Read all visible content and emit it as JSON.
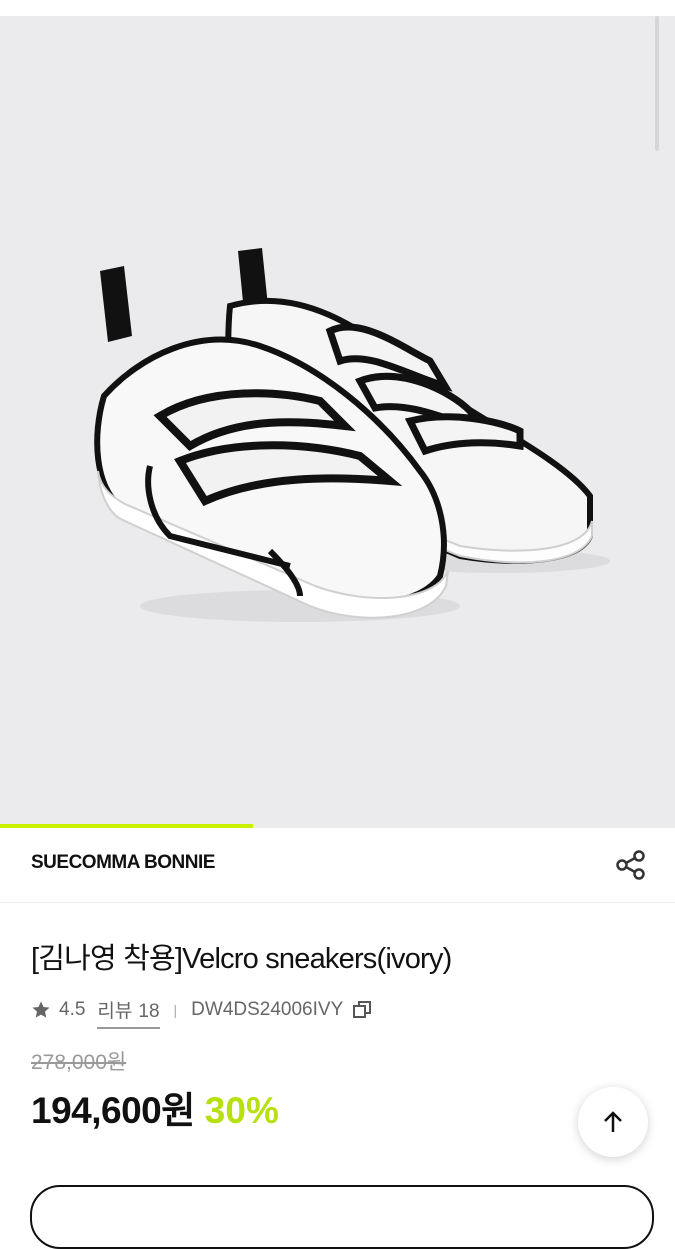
{
  "gallery": {
    "image_alt": "Velcro sneakers ivory product photo",
    "progress_fraction": 0.375
  },
  "brand": {
    "name": "SUECOMMA BONNIE",
    "share_icon": "share-icon"
  },
  "product": {
    "title": "[김나영 착용]Velcro sneakers(ivory)",
    "rating": "4.5",
    "review_label": "리뷰",
    "review_count": "18",
    "separator": "|",
    "code": "DW4DS24006IVY",
    "original_price": "278,000원",
    "sale_price": "194,600원",
    "discount": "30%"
  },
  "colors": {
    "accent": "#c8f000",
    "discount": "#b6e10e"
  },
  "icons": [
    "star-icon",
    "copy-icon",
    "share-icon",
    "arrow-up-icon"
  ]
}
